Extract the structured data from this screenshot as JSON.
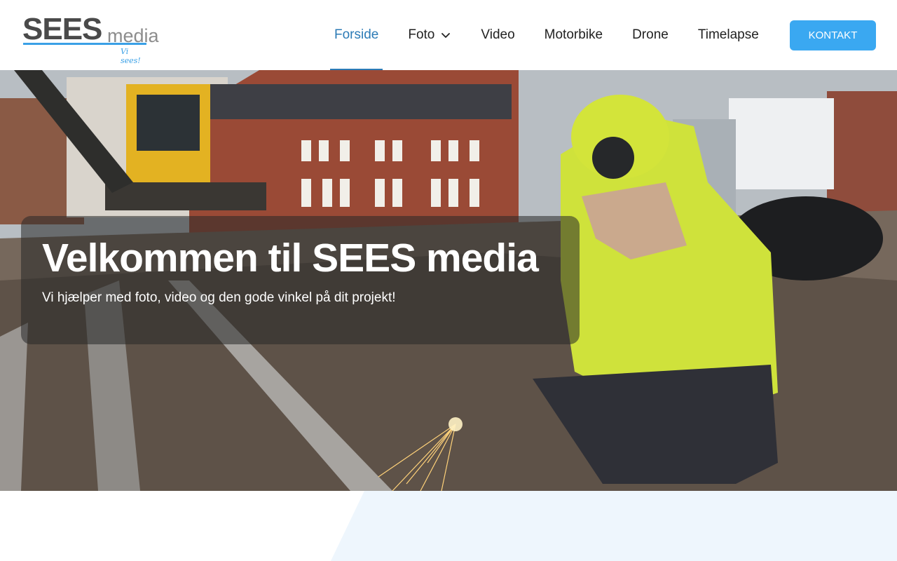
{
  "logo": {
    "main": "SEES",
    "sub": "media",
    "tagline": "Vi sees!"
  },
  "nav": {
    "items": [
      {
        "label": "Forside",
        "active": true
      },
      {
        "label": "Foto",
        "has_dropdown": true
      },
      {
        "label": "Video"
      },
      {
        "label": "Motorbike"
      },
      {
        "label": "Drone"
      },
      {
        "label": "Timelapse"
      }
    ],
    "cta": "KONTAKT"
  },
  "hero": {
    "title": "Velkommen til SEES media",
    "subtitle": "Vi hjælper med foto, video og den gode vinkel på dit projekt!"
  },
  "colors": {
    "accent": "#3aa8f1",
    "active_nav": "#2c7bb6",
    "text": "#222222",
    "below_shape": "#eef6fd"
  },
  "icons": {
    "dropdown": "chevron-down-icon"
  }
}
